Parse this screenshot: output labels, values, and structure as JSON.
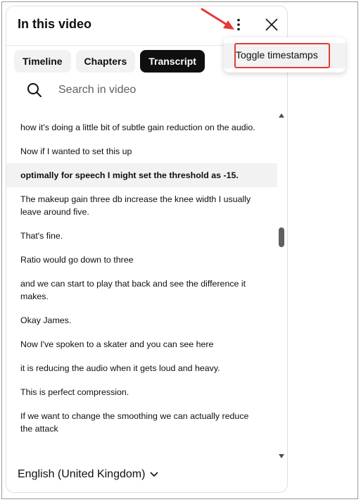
{
  "panel": {
    "title": "In this video",
    "more_icon": "more-vert-icon",
    "close_icon": "close-icon"
  },
  "tabs": [
    {
      "label": "Timeline",
      "active": false
    },
    {
      "label": "Chapters",
      "active": false
    },
    {
      "label": "Transcript",
      "active": true
    }
  ],
  "search": {
    "placeholder": "Search in video",
    "icon": "search-icon"
  },
  "transcript": {
    "segments": [
      {
        "text": "how it's doing a little bit of subtle gain reduction on the audio."
      },
      {
        "text": "Now if I wanted to set this up"
      },
      {
        "text": "optimally for speech I might set the threshold as -15.",
        "active": true
      },
      {
        "text": "The makeup gain three db increase the knee width I usually leave around five."
      },
      {
        "text": "That's fine."
      },
      {
        "text": "Ratio would go down to three"
      },
      {
        "text": "and we can start to play that back and see the difference it makes."
      },
      {
        "text": "Okay James."
      },
      {
        "text": "Now I've spoken to a skater and you can see here"
      },
      {
        "text": "it is reducing the audio when it gets loud and heavy."
      },
      {
        "text": "This is perfect compression."
      },
      {
        "text": "If we want to change the smoothing we can actually reduce the attack"
      }
    ]
  },
  "language": {
    "label": "English (United Kingdom)",
    "icon": "chevron-down-icon"
  },
  "menu": {
    "items": [
      {
        "label": "Toggle timestamps"
      }
    ]
  },
  "annotation": {
    "arrow_color": "#e53935",
    "box_color": "#e53935"
  }
}
